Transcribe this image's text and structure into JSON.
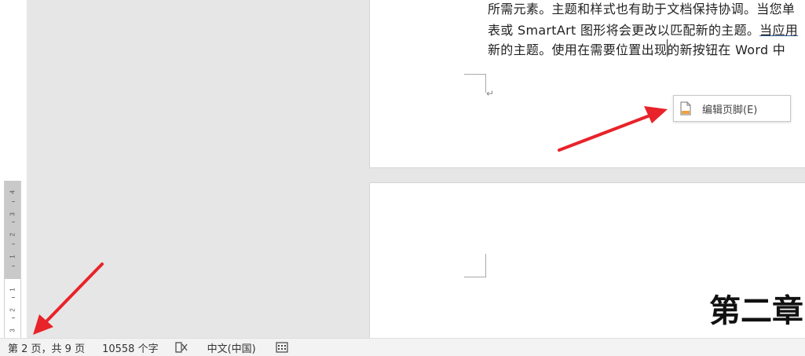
{
  "document": {
    "lines": [
      "所需元素。主题和样式也有助于文档保持协调。当您单",
      "表或 SmartArt 图形将会更改以匹配新的主题。",
      "当应用",
      "新的主题。使用在需要位置出现的新按钮在 Word 中"
    ],
    "paragraph_mark": "↵",
    "next_page_heading": "第二章"
  },
  "footer_popup": {
    "label": "编辑页脚(E)",
    "icon": "document-icon"
  },
  "ruler": {
    "numbers": [
      "4",
      "3",
      "2",
      "1",
      "1",
      "2",
      "3"
    ]
  },
  "statusbar": {
    "page_info": "第 2 页，共 9 页",
    "word_count": "10558 个字",
    "proofing_icon": "proofing-icon",
    "language": "中文(中国)",
    "accessibility_icon": "accessibility-icon"
  },
  "annotations": {
    "arrow_color": "#e8232a"
  }
}
